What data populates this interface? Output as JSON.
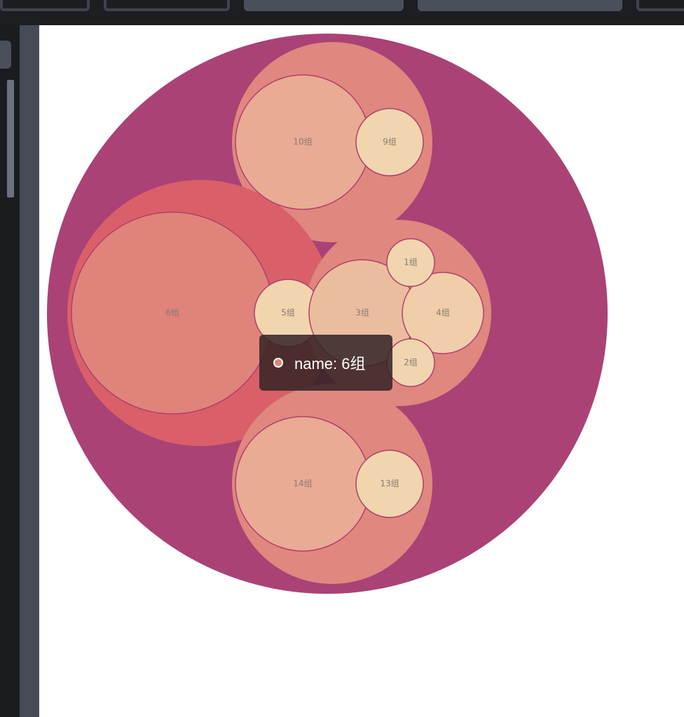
{
  "chart_data": {
    "type": "circle-packing",
    "colors": {
      "root": "#aa4276",
      "group_a": "#e0877f",
      "group_b": "#d96069",
      "leaf_large": "#e9ab94",
      "leaf_6": "#e0837b",
      "leaf_small": "#f0d5ae",
      "leaf_3": "#ebbd9f",
      "leaf_4": "#efcea9",
      "leaf_stroke": "#b0406e",
      "label": "#8a7a72"
    },
    "nodes": [
      {
        "name": "10组",
        "group": "top"
      },
      {
        "name": "9组",
        "group": "top"
      },
      {
        "name": "6组",
        "group": "left"
      },
      {
        "name": "5组",
        "group": "left"
      },
      {
        "name": "3组",
        "group": "right"
      },
      {
        "name": "4组",
        "group": "right"
      },
      {
        "name": "1组",
        "group": "right"
      },
      {
        "name": "2组",
        "group": "right"
      },
      {
        "name": "14组",
        "group": "bottom"
      },
      {
        "name": "13组",
        "group": "bottom"
      }
    ]
  },
  "tooltip": {
    "text": "name: 6组",
    "dot_color": "#e0837b"
  }
}
